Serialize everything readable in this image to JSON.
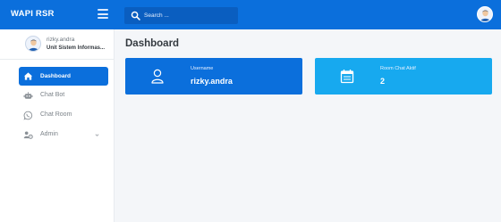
{
  "header": {
    "brand": "WAPI RSR",
    "search_placeholder": "Search ..."
  },
  "sidebar": {
    "user": {
      "name": "rizky.andra",
      "unit": "Unit Sistem Informas..."
    },
    "items": [
      {
        "label": "Dashboard",
        "icon": "home-icon",
        "active": true
      },
      {
        "label": "Chat Bot",
        "icon": "robot-icon",
        "active": false
      },
      {
        "label": "Chat Room",
        "icon": "whatsapp-icon",
        "active": false
      },
      {
        "label": "Admin",
        "icon": "users-gear-icon",
        "active": false,
        "has_submenu": true
      }
    ]
  },
  "main": {
    "title": "Dashboard",
    "cards": [
      {
        "label": "Username",
        "value": "rizky.andra",
        "icon": "user-icon",
        "color": "#0b6fdc"
      },
      {
        "label": "Room Chat Aktif",
        "value": "2",
        "icon": "calendar-icon",
        "color": "#17a9ef"
      }
    ]
  },
  "colors": {
    "primary": "#0b6fdc",
    "info": "#17a9ef",
    "background": "#f4f6f9"
  }
}
